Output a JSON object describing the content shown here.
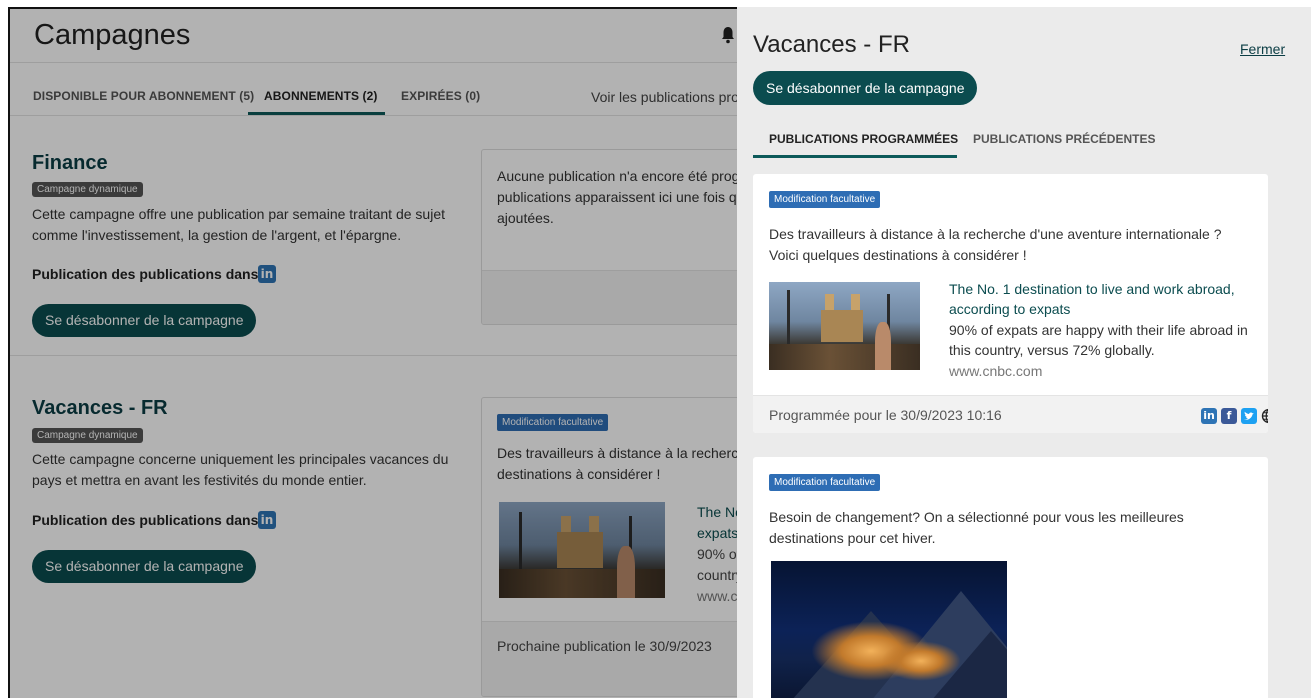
{
  "page": {
    "title": "Campagnes",
    "tabs": [
      {
        "label": "DISPONIBLE POUR ABONNEMENT (5)"
      },
      {
        "label": "ABONNEMENTS (2)"
      },
      {
        "label": "EXPIRÉES (0)"
      }
    ],
    "tabs_link": "Voir les publications pro"
  },
  "campaigns": [
    {
      "title": "Finance",
      "badge": "Campagne dynamique",
      "description": "Cette campagne offre une publication par semaine traitant de sujet comme l'investissement, la gestion de l'argent, et l'épargne.",
      "publish_label": "Publication des publications dans :",
      "network_icon": "linkedin-icon",
      "unsubscribe": "Se désabonner de la campagne",
      "preview_text": "Aucune publication n'a encore été progra publications apparaissent ici une fois qu ajoutées."
    },
    {
      "title": "Vacances - FR",
      "badge": "Campagne dynamique",
      "description": "Cette campagne concerne uniquement les principales vacances du pays et mettra en avant les festivités du monde entier.",
      "publish_label": "Publication des publications dans :",
      "network_icon": "linkedin-icon",
      "unsubscribe": "Se désabonner de la campagne",
      "preview_badge": "Modification facultative",
      "preview_text": "Des travailleurs à distance à la recherche destinations à considérer !",
      "preview_link_lines": [
        "The No",
        "expats"
      ],
      "preview_desc_lines": [
        "90% of",
        "country"
      ],
      "preview_url": "www.cr",
      "next_publication": "Prochaine publication le 30/9/2023"
    }
  ],
  "drawer": {
    "title": "Vacances - FR",
    "close": "Fermer",
    "unsubscribe": "Se désabonner de la campagne",
    "tabs": [
      {
        "label": "PUBLICATIONS PROGRAMMÉES"
      },
      {
        "label": "PUBLICATIONS PRÉCÉDENTES"
      }
    ],
    "posts": [
      {
        "badge": "Modification facultative",
        "text": "Des travailleurs à distance à la recherche d'une aventure internationale ? Voici quelques destinations à considérer !",
        "link_title": "The No. 1 destination to live and work abroad, according to expats",
        "link_desc": "90% of expats are happy with their life abroad in this country, versus 72% globally.",
        "link_url": "www.cnbc.com",
        "scheduled": "Programmée pour le 30/9/2023 10:16",
        "networks": [
          "linkedin-icon",
          "facebook-icon",
          "twitter-icon",
          "globe-icon"
        ]
      },
      {
        "badge": "Modification facultative",
        "text": "Besoin de changement? On a sélectionné pour vous les meilleures destinations pour cet hiver."
      }
    ]
  },
  "colors": {
    "accent": "#0b4c4f",
    "badge_blue": "#2e6db4",
    "linkedin": "#2e74b5",
    "facebook": "#3b5998",
    "twitter": "#1da1f2"
  }
}
